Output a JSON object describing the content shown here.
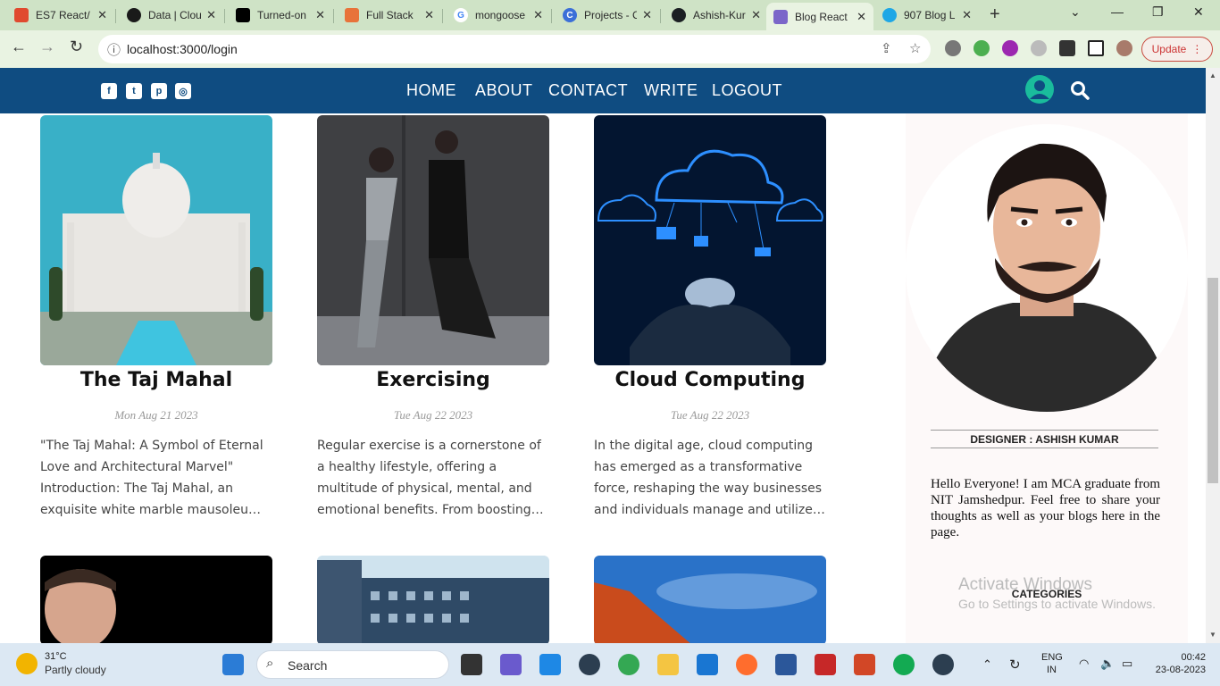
{
  "browser": {
    "tabs": [
      {
        "title": "ES7 React/",
        "color": "#e04a2f"
      },
      {
        "title": "Data | Clou",
        "color": "#1a1a1a"
      },
      {
        "title": "Turned-on",
        "color": "#000000"
      },
      {
        "title": "Full Stack",
        "color": "#e8733a"
      },
      {
        "title": "mongoose",
        "color": "#4285f4"
      },
      {
        "title": "Projects - C",
        "color": "#3b6fd8"
      },
      {
        "title": "Ashish-Kur",
        "color": "#1b1f23"
      },
      {
        "title": "Blog React",
        "color": "#7b66c9"
      },
      {
        "title": "907 Blog L",
        "color": "#1ea7e6"
      }
    ],
    "url": "localhost:3000/login",
    "update_label": "Update"
  },
  "site": {
    "nav": [
      "HOME",
      "ABOUT",
      "CONTACT",
      "WRITE",
      "LOGOUT"
    ],
    "social": [
      "facebook-icon",
      "twitter-icon",
      "pinterest-icon",
      "instagram-icon"
    ]
  },
  "posts": [
    {
      "title": "The Taj Mahal",
      "date": "Mon Aug 21 2023",
      "desc": "\"The Taj Mahal: A Symbol of Eternal Love and Architectural Marvel\" Introduction: The Taj Mahal, an exquisite white marble mausoleum, stands as a testament"
    },
    {
      "title": "Exercising",
      "date": "Tue Aug 22 2023",
      "desc": "Regular exercise is a cornerstone of a healthy lifestyle, offering a multitude of physical, mental, and emotional benefits. From boosting cardiovascular health"
    },
    {
      "title": "Cloud Computing",
      "date": "Tue Aug 22 2023",
      "desc": "In the digital age, cloud computing has emerged as a transformative force, reshaping the way businesses and individuals manage and utilize their IT resources"
    }
  ],
  "sidebar": {
    "designer": "DESIGNER : ASHISH KUMAR",
    "about": "Hello Everyone! I am MCA graduate from NIT Jamshedpur. Feel free to share your thoughts as well as your blogs here in the page.",
    "categories": "CATEGORIES"
  },
  "watermark": {
    "line1": "Activate Windows",
    "line2": "Go to Settings to activate Windows."
  },
  "taskbar": {
    "temp": "31°C",
    "weather": "Partly cloudy",
    "search": "Search",
    "lang1": "ENG",
    "lang2": "IN",
    "time": "00:42",
    "date": "23-08-2023"
  },
  "colors": {
    "header": "#0f4c81",
    "accent": "#1abc9c"
  }
}
